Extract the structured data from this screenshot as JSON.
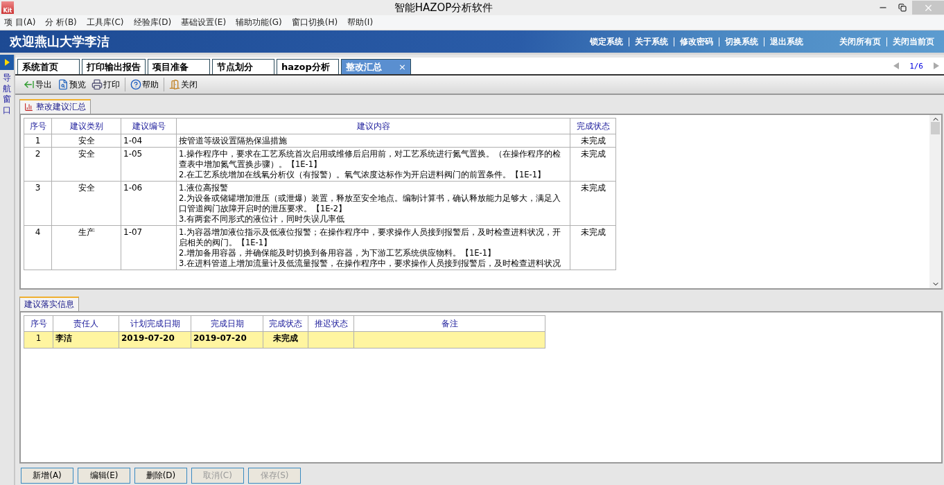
{
  "window": {
    "title": "智能HAZOP分析软件",
    "app_icon": "Kit"
  },
  "menu": [
    "项 目(A)",
    "分 析(B)",
    "工具库(C)",
    "经验库(D)",
    "基础设置(E)",
    "辅助功能(G)",
    "窗口切换(H)",
    "帮助(I)"
  ],
  "banner": {
    "welcome": "欢迎燕山大学李洁",
    "links": [
      "锁定系统",
      "关于系统",
      "修改密码",
      "切换系统",
      "退出系统"
    ],
    "page_links": [
      "关闭所有页",
      "关闭当前页"
    ]
  },
  "nav": {
    "label": "导航窗口"
  },
  "tabs": [
    {
      "label": "系统首页",
      "selected": false
    },
    {
      "label": "打印输出报告",
      "selected": false
    },
    {
      "label": "项目准备",
      "selected": false
    },
    {
      "label": "节点划分",
      "selected": false
    },
    {
      "label": "hazop分析",
      "selected": false
    },
    {
      "label": "整改汇总",
      "selected": true,
      "close": "×"
    }
  ],
  "pager": "1/6",
  "toolbar": [
    {
      "kind": "export",
      "label": "导出"
    },
    {
      "kind": "preview",
      "label": "预览"
    },
    {
      "kind": "print",
      "label": "打印"
    },
    {
      "kind": "help",
      "label": "帮助"
    },
    {
      "kind": "close",
      "label": "关闭"
    }
  ],
  "suggestions": {
    "tab": "整改建议汇总",
    "columns": [
      "序号",
      "建议类别",
      "建议编号",
      "建议内容",
      "完成状态"
    ],
    "rows": [
      {
        "no": "1",
        "category": "安全",
        "code": "1-04",
        "content": [
          "按管道等级设置隔热保温措施"
        ],
        "status": "未完成"
      },
      {
        "no": "2",
        "category": "安全",
        "code": "1-05",
        "content": [
          "1.操作程序中，要求在工艺系统首次启用或维修后启用前，对工艺系统进行氮气置换。（在操作程序的检查表中增加氮气置换步骤）。【1E-1】",
          "2.在工艺系统增加在线氧分析仪（有报警）。氧气浓度达标作为开启进料阀门的前置条件。【1E-1】"
        ],
        "status": "未完成"
      },
      {
        "no": "3",
        "category": "安全",
        "code": "1-06",
        "content": [
          "1.液位高报警",
          "2.为设备或储罐增加泄压（或泄爆）装置，释放至安全地点。编制计算书，确认释放能力足够大，满足入口管道阀门故障开启时的泄压要求。【1E-2】",
          "3.有两套不同形式的液位计，同时失误几率低"
        ],
        "status": "未完成"
      },
      {
        "no": "4",
        "category": "生产",
        "code": "1-07",
        "content": [
          "1.为容器增加液位指示及低液位报警；在操作程序中，要求操作人员接到报警后，及时检查进料状况，开启相关的阀门。【1E-1】",
          "2.增加备用容器，并确保能及时切换到备用容器，为下游工艺系统供应物料。【1E-1】",
          "3.在进料管道上增加流量计及低流量报警，在操作程序中，要求操作人员接到报警后，及时检查进料状况"
        ],
        "status": "未完成"
      }
    ]
  },
  "implementation": {
    "tab": "建议落实信息",
    "columns": [
      "序号",
      "责任人",
      "计划完成日期",
      "完成日期",
      "完成状态",
      "推迟状态",
      "备注"
    ],
    "rows": [
      {
        "selected": true,
        "cells": [
          "1",
          "李洁",
          "2019-07-20",
          "2019-07-20",
          "未完成",
          "",
          ""
        ]
      }
    ]
  },
  "buttons": [
    {
      "label": "新增(A)",
      "disabled": false
    },
    {
      "label": "编辑(E)",
      "disabled": false
    },
    {
      "label": "删除(D)",
      "disabled": false
    },
    {
      "label": "取消(C)",
      "disabled": true
    },
    {
      "label": "保存(S)",
      "disabled": true
    }
  ]
}
